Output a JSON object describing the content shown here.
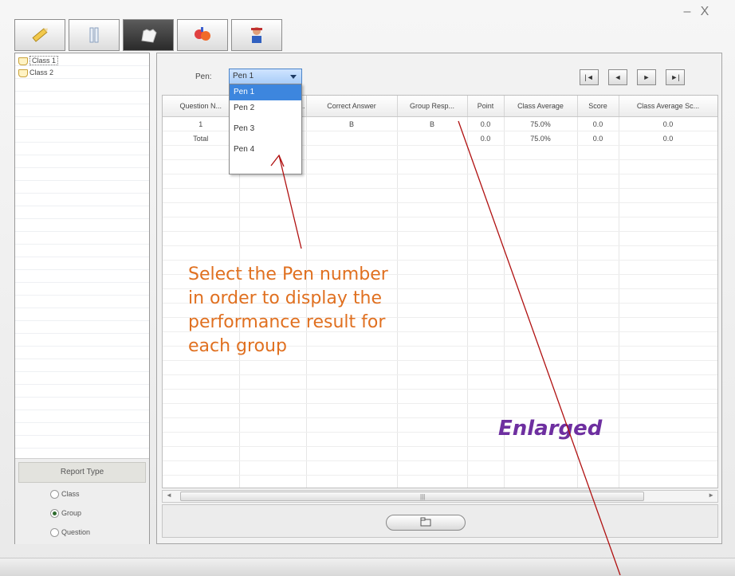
{
  "window": {
    "minimize_label": "–",
    "close_label": "X"
  },
  "toolbar": {
    "tabs": [
      {
        "icon": "pencil-icon"
      },
      {
        "icon": "bottle-icon"
      },
      {
        "icon": "hand-icon",
        "active": true
      },
      {
        "icon": "gloves-icon"
      },
      {
        "icon": "user-icon"
      }
    ]
  },
  "sidebar": {
    "classes": [
      "Class 1",
      "Class 2"
    ],
    "report_type": {
      "title": "Report Type",
      "options": [
        "Class",
        "Group",
        "Question"
      ],
      "selected": "Group"
    }
  },
  "main": {
    "pen_label": "Pen:",
    "pen_selected": "Pen 1",
    "pen_options": [
      "Pen 1",
      "Pen 2",
      "Pen 3",
      "Pen 4"
    ],
    "table": {
      "headers": [
        "Question N...",
        "...",
        "Correct Answer",
        "Group Resp...",
        "Point",
        "Class Average",
        "Score",
        "Class Average Sc..."
      ],
      "rows": [
        [
          "1",
          "",
          "B",
          "B",
          "0.0",
          "75.0%",
          "0.0",
          "0.0"
        ],
        [
          "Total",
          "",
          "",
          "",
          "0.0",
          "75.0%",
          "0.0",
          "0.0"
        ]
      ]
    }
  },
  "annotations": {
    "instruction_lines": [
      "Select the Pen number",
      "in order to display the",
      "performance result for",
      "each group"
    ],
    "enlarged": "Enlarged"
  },
  "colors": {
    "annotation": "#e07020",
    "enlarged": "#6e2fa0",
    "arrow": "#b01010",
    "selection": "#3d86de"
  }
}
